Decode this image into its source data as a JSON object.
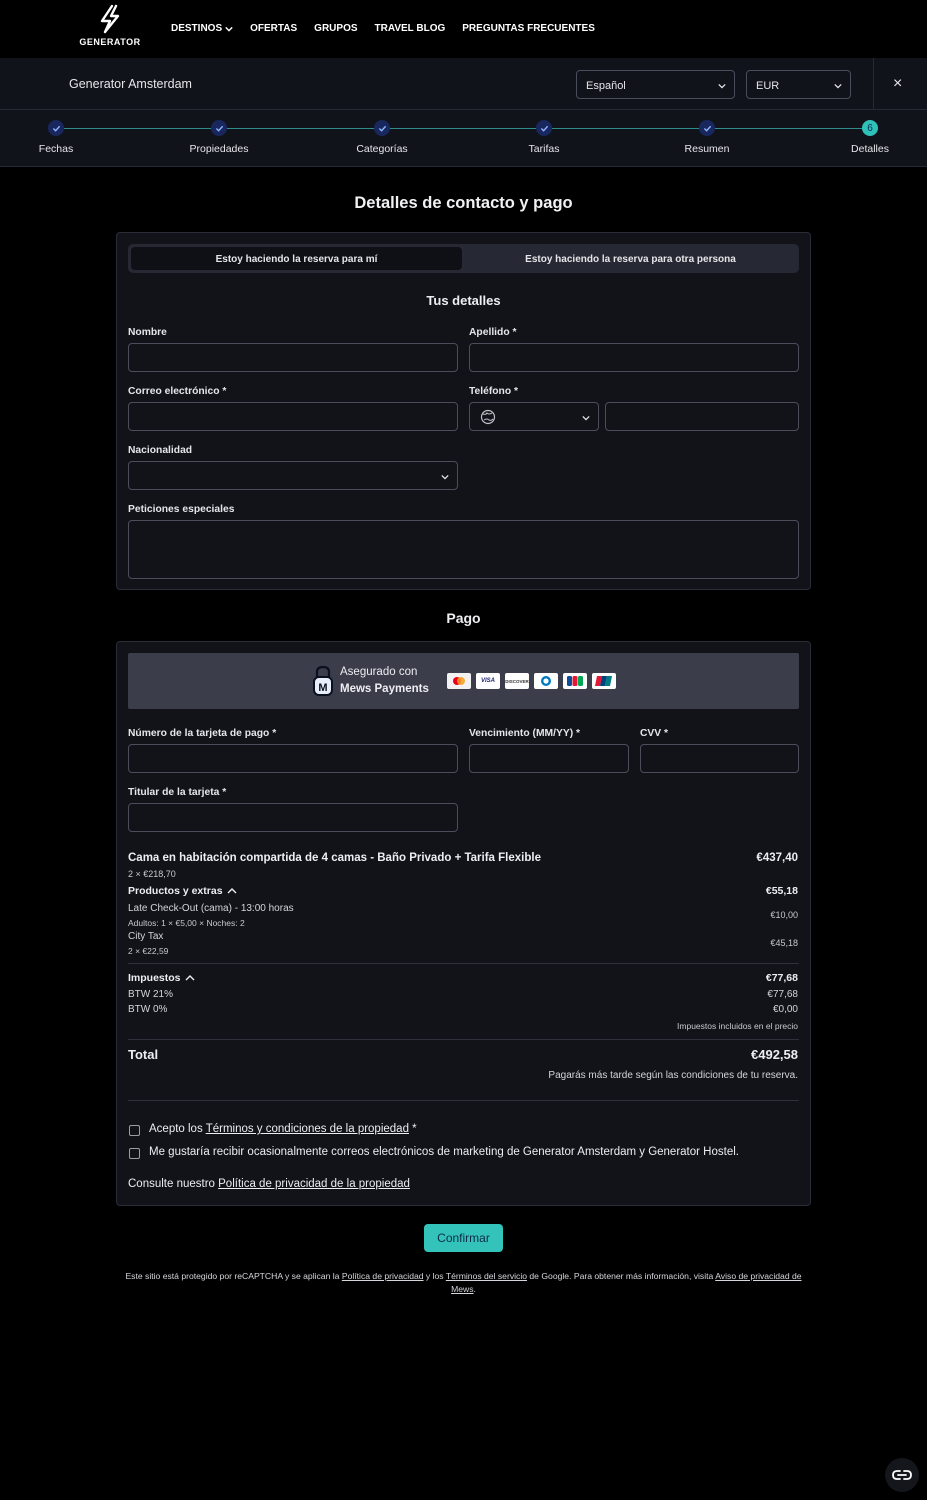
{
  "nav": {
    "logo_text": "GENERATOR",
    "items": [
      "DESTINOS",
      "OFERTAS",
      "GRUPOS",
      "TRAVEL BLOG",
      "PREGUNTAS FRECUENTES"
    ]
  },
  "subheader": {
    "hotel": "Generator Amsterdam",
    "language": "Español",
    "currency": "EUR",
    "close": "×"
  },
  "steps": [
    {
      "label": "Fechas",
      "state": "done"
    },
    {
      "label": "Propiedades",
      "state": "done"
    },
    {
      "label": "Categorías",
      "state": "done"
    },
    {
      "label": "Tarifas",
      "state": "done"
    },
    {
      "label": "Resumen",
      "state": "done"
    },
    {
      "label": "Detalles",
      "state": "active",
      "number": "6"
    }
  ],
  "page_title": "Detalles de contacto y pago",
  "contact": {
    "toggle_me": "Estoy haciendo la reserva para mí",
    "toggle_other": "Estoy haciendo la reserva para otra persona",
    "section_title": "Tus detalles",
    "first_name_label": "Nombre",
    "last_name_label": "Apellido *",
    "email_label": "Correo electrónico *",
    "phone_label": "Teléfono *",
    "nationality_label": "Nacionalidad",
    "requests_label": "Peticiones especiales"
  },
  "payment": {
    "section_title": "Pago",
    "secured_line1": "Asegurado con",
    "secured_line2": "Mews Payments",
    "card_brands": [
      "mastercard",
      "VISA",
      "DISCOVER",
      "diners",
      "JCB",
      "unionpay"
    ],
    "card_number_label": "Número de la tarjeta de pago *",
    "expiry_label": "Vencimiento (MM/YY) *",
    "cvv_label": "CVV *",
    "holder_label": "Titular de la tarjeta *"
  },
  "summary": {
    "room_title": "Cama en habitación compartida de 4 camas - Baño Privado + Tarifa Flexible",
    "room_detail": "2 × €218,70",
    "room_amount": "€437,40",
    "extras_label": "Productos y extras",
    "extras_amount": "€55,18",
    "late_checkout_title": "Late Check-Out (cama) - 13:00 horas",
    "late_checkout_detail": "Adultos: 1 × €5,00 × Noches: 2",
    "late_checkout_amount": "€10,00",
    "city_tax_title": "City Tax",
    "city_tax_detail": "2 × €22,59",
    "city_tax_amount": "€45,18",
    "taxes_label": "Impuestos",
    "taxes_amount": "€77,68",
    "btw21_label": "BTW 21%",
    "btw21_amount": "€77,68",
    "btw0_label": "BTW 0%",
    "btw0_amount": "€0,00",
    "taxes_note": "Impuestos incluidos en el precio",
    "total_label": "Total",
    "total_amount": "€492,58",
    "pay_later_note": "Pagarás más tarde según las condiciones de tu reserva."
  },
  "consent": {
    "terms_prefix": "Acepto los ",
    "terms_link": "Términos y condiciones de la propiedad",
    "terms_suffix": " *",
    "marketing": "Me gustaría recibir ocasionalmente correos electrónicos de marketing de Generator Amsterdam y Generator Hostel.",
    "privacy_prefix": "Consulte nuestro ",
    "privacy_link": "Política de privacidad de la propiedad"
  },
  "confirm_button": "Confirmar",
  "recaptcha": {
    "p1": "Este sitio está protegido por reCAPTCHA y se aplican la ",
    "link1": "Política de privacidad",
    "p2": " y los ",
    "link2": "Términos del servicio",
    "p3": " de Google. Para obtener más información, visita ",
    "link3": "Aviso de privacidad de Mews",
    "p4": "."
  },
  "colors": {
    "accent": "#34c3ba",
    "step_done": "#18275e",
    "background": "#000000",
    "card_bg": "#121319"
  }
}
